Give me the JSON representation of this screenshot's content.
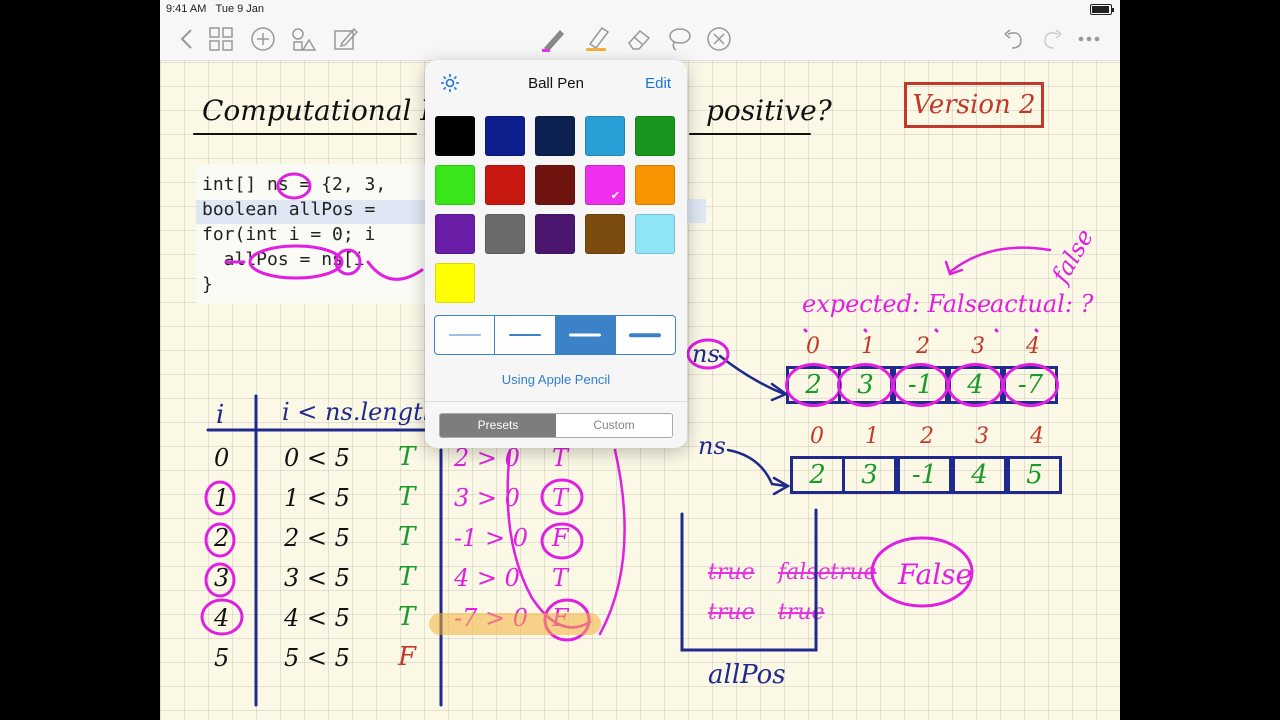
{
  "status": {
    "time": "9:41 AM",
    "date": "Tue 9 Jan"
  },
  "toolbar": {
    "left_icons": [
      "chevron-left-icon",
      "grid-icon",
      "plus-circle-icon",
      "shapes-icon",
      "pencil-square-icon"
    ],
    "tool_icons": [
      "ball-pen-icon",
      "highlighter-icon",
      "eraser-icon",
      "lasso-icon",
      "close-circle-icon"
    ],
    "right_icons": [
      "undo-icon",
      "redo-icon",
      "more-icon"
    ]
  },
  "popover": {
    "title": "Ball Pen",
    "edit": "Edit",
    "colors": [
      "#000000",
      "#0d1f8c",
      "#0d2150",
      "#2a9fd6",
      "#19961e",
      "#39e619",
      "#c71910",
      "#701410",
      "#ee2fee",
      "#f79400",
      "#6a1da6",
      "#6b6b6b",
      "#4a1670",
      "#7a4c0d",
      "#8fe5f7",
      "#ffff00"
    ],
    "selected_color": "#ee2fee",
    "selected_width_index": 2,
    "using_pencil": "Using Apple Pencil",
    "presets_label": "Presets",
    "custom_label": "Custom",
    "active_segment": "Presets"
  },
  "notebook": {
    "heading_left": "Computational Proble",
    "heading_right": "positive?",
    "version": "Version 2",
    "code_lines": [
      "int[] ns = {2, 3,",
      "boolean allPos =",
      "for(int i = 0; i",
      "  allPos = ns[i",
      "}"
    ],
    "table_headers": [
      "i",
      "i < ns.length"
    ],
    "table_i": [
      "0",
      "1",
      "2",
      "3",
      "4",
      "5"
    ],
    "table_cond": [
      "0 < 5",
      "1 < 5",
      "2 < 5",
      "3 < 5",
      "4 < 5",
      "5 < 5"
    ],
    "table_tf": [
      "T",
      "T",
      "T",
      "T",
      "T",
      "F"
    ],
    "table_eval": [
      "2 > 0",
      "3 > 0",
      "-1 > 0",
      "4 > 0",
      "-7 > 0"
    ],
    "table_eval_result": [
      "T",
      "T",
      "F",
      "T",
      "F"
    ],
    "expected_label": "expected: False",
    "actual_label": "actual: ?",
    "actual_note": "false",
    "array1_label": "ns",
    "array1_indices": [
      "0",
      "1",
      "2",
      "3",
      "4"
    ],
    "array1_values": [
      "2",
      "3",
      "-1",
      "4",
      "-7"
    ],
    "array2_label": "ns",
    "array2_indices": [
      "0",
      "1",
      "2",
      "3",
      "4"
    ],
    "array2_values": [
      "2",
      "3",
      "-1",
      "4",
      "5"
    ],
    "allpos_label": "allPos",
    "allpos_history": [
      "true",
      "false",
      "true",
      "true",
      "true"
    ],
    "allpos_final": "False"
  }
}
